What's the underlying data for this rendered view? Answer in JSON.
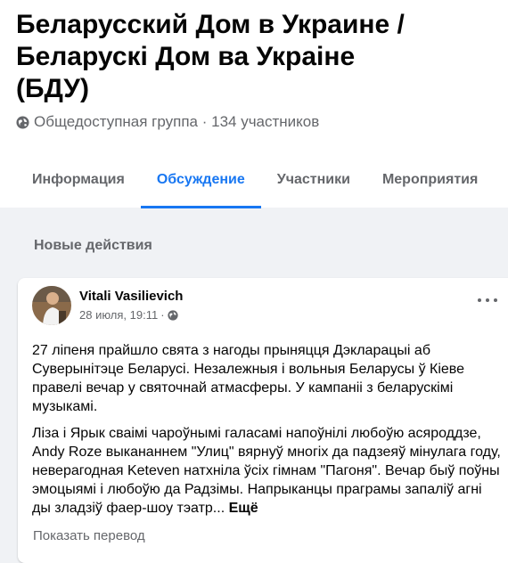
{
  "group": {
    "title_line1": "Беларусский Дом в Украине /",
    "title_line2": "Беларускі Дом ва Украіне",
    "title_line3": "(БДУ)",
    "privacy": "Общедоступная группа",
    "separator": " · ",
    "members": "134 участников"
  },
  "tabs": [
    {
      "label": "Информация"
    },
    {
      "label": "Обсуждение"
    },
    {
      "label": "Участники"
    },
    {
      "label": "Мероприятия"
    }
  ],
  "feed": {
    "section_label": "Новые действия"
  },
  "post": {
    "author": "Vitali Vasilievich",
    "date": "28 июля, 19:11",
    "date_sep": "·",
    "paragraph1": "27 ліпеня прайшло свята з нагоды прыняцця Дэкларацыі аб Суверынітэце Беларусі. Незалежныя і вольныя Беларусы ў Кіеве правелі вечар у святочнай атмасферы. У кампаніі з беларускімі музыкамі.",
    "paragraph2": "Ліза і Ярык сваімі чароўнымі галасамі напоўнілі любоўю асяроддзе, Andy Roze выкананнем \"Улиц\" вярнуў многіх да падзеяў мінулага году, неверагодная Keteven натхніла ўсіх гімнам \"Пагоня\". Вечар быў поўны эмоцыямі і любоўю да Радзімы. Напрыканцы праграмы запаліў агні ды зладзіў фаер-шоу тэатр...",
    "see_more": "Ещё",
    "translate": "Показать перевод"
  },
  "colors": {
    "accent": "#1877f2",
    "secondary_text": "#65676b",
    "background": "#f0f2f5"
  }
}
